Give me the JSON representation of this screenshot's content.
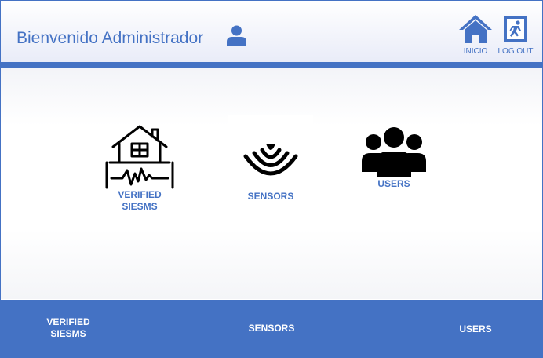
{
  "header": {
    "title": "Bienvenido Administrador",
    "user_icon": "user-icon",
    "nav": [
      {
        "label": "INICIO",
        "icon": "home-icon"
      },
      {
        "label": "LOG OUT",
        "icon": "exit-icon"
      }
    ]
  },
  "tiles": [
    {
      "line1": "VERIFIED",
      "line2": "SIESMS",
      "icon": "house-earthquake-icon"
    },
    {
      "label": "SENSORS",
      "icon": "sensor-waves-icon"
    },
    {
      "label": "USERS",
      "icon": "users-group-icon"
    }
  ],
  "footer": {
    "links": [
      {
        "line1": "VERIFIED",
        "line2": "SIESMS"
      },
      {
        "label": "SENSORS"
      },
      {
        "label": "USERS"
      }
    ]
  },
  "colors": {
    "accent": "#4472c4",
    "icon_dark": "#000000",
    "footer_text": "#ffffff"
  }
}
